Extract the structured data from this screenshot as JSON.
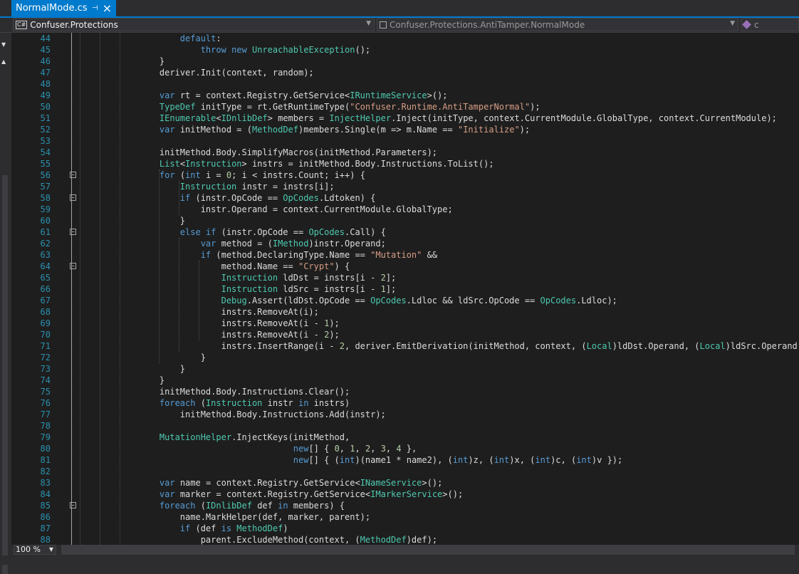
{
  "tab": {
    "title": "NormalMode.cs",
    "pin": "⊣",
    "close": "×"
  },
  "nav": {
    "project_badge": "C#",
    "project": "Confuser.Protections",
    "type": "Confuser.Protections.AntiTamper.NormalMode",
    "member": "c"
  },
  "status": {
    "zoom": "100 %"
  },
  "colors": {
    "accent": "#007acc",
    "line_number": "#2b91af",
    "keyword": "#569cd6",
    "type": "#4ec9b0",
    "string": "#d69d85",
    "number": "#b5cea8"
  },
  "code_lines": [
    {
      "n": "44",
      "fold": false,
      "t": [
        [
          "tx",
          "        "
        ],
        [
          "kw",
          "default"
        ],
        [
          "tx",
          ":"
        ]
      ]
    },
    {
      "n": "45",
      "fold": false,
      "t": [
        [
          "tx",
          "            "
        ],
        [
          "kw",
          "throw"
        ],
        [
          "tx",
          " "
        ],
        [
          "kw",
          "new"
        ],
        [
          "tx",
          " "
        ],
        [
          "ty",
          "UnreachableException"
        ],
        [
          "tx",
          "();"
        ]
      ]
    },
    {
      "n": "46",
      "fold": false,
      "t": [
        [
          "tx",
          "    }"
        ]
      ]
    },
    {
      "n": "47",
      "fold": false,
      "t": [
        [
          "tx",
          "    deriver.Init(context, random);"
        ]
      ]
    },
    {
      "n": "48",
      "fold": false,
      "t": []
    },
    {
      "n": "49",
      "fold": false,
      "t": [
        [
          "tx",
          "    "
        ],
        [
          "kw",
          "var"
        ],
        [
          "tx",
          " rt = context.Registry.GetService<"
        ],
        [
          "ty",
          "IRuntimeService"
        ],
        [
          "tx",
          ">();"
        ]
      ]
    },
    {
      "n": "50",
      "fold": false,
      "t": [
        [
          "tx",
          "    "
        ],
        [
          "ty",
          "TypeDef"
        ],
        [
          "tx",
          " initType = rt.GetRuntimeType("
        ],
        [
          "st",
          "\"Confuser.Runtime.AntiTamperNormal\""
        ],
        [
          "tx",
          ");"
        ]
      ]
    },
    {
      "n": "51",
      "fold": false,
      "t": [
        [
          "tx",
          "    "
        ],
        [
          "ty",
          "IEnumerable"
        ],
        [
          "tx",
          "<"
        ],
        [
          "ty",
          "IDnlibDef"
        ],
        [
          "tx",
          "> members = "
        ],
        [
          "ty",
          "InjectHelper"
        ],
        [
          "tx",
          ".Inject(initType, context.CurrentModule.GlobalType, context.CurrentModule);"
        ]
      ]
    },
    {
      "n": "52",
      "fold": false,
      "t": [
        [
          "tx",
          "    "
        ],
        [
          "kw",
          "var"
        ],
        [
          "tx",
          " initMethod = ("
        ],
        [
          "ty",
          "MethodDef"
        ],
        [
          "tx",
          ")members.Single(m => m.Name == "
        ],
        [
          "st",
          "\"Initialize\""
        ],
        [
          "tx",
          ");"
        ]
      ]
    },
    {
      "n": "53",
      "fold": false,
      "t": []
    },
    {
      "n": "54",
      "fold": false,
      "t": [
        [
          "tx",
          "    initMethod.Body.SimplifyMacros(initMethod.Parameters);"
        ]
      ]
    },
    {
      "n": "55",
      "fold": false,
      "t": [
        [
          "tx",
          "    "
        ],
        [
          "ty",
          "List"
        ],
        [
          "tx",
          "<"
        ],
        [
          "ty",
          "Instruction"
        ],
        [
          "tx",
          "> instrs = initMethod.Body.Instructions.ToList();"
        ]
      ]
    },
    {
      "n": "56",
      "fold": true,
      "t": [
        [
          "tx",
          "    "
        ],
        [
          "kw",
          "for"
        ],
        [
          "tx",
          " ("
        ],
        [
          "kw",
          "int"
        ],
        [
          "tx",
          " i = "
        ],
        [
          "nm",
          "0"
        ],
        [
          "tx",
          "; i < instrs.Count; i++) {"
        ]
      ]
    },
    {
      "n": "57",
      "fold": false,
      "t": [
        [
          "tx",
          "        "
        ],
        [
          "ty",
          "Instruction"
        ],
        [
          "tx",
          " instr = instrs[i];"
        ]
      ]
    },
    {
      "n": "58",
      "fold": true,
      "t": [
        [
          "tx",
          "        "
        ],
        [
          "kw",
          "if"
        ],
        [
          "tx",
          " (instr.OpCode == "
        ],
        [
          "ty",
          "OpCodes"
        ],
        [
          "tx",
          ".Ldtoken) {"
        ]
      ]
    },
    {
      "n": "59",
      "fold": false,
      "t": [
        [
          "tx",
          "            instr.Operand = context.CurrentModule.GlobalType;"
        ]
      ]
    },
    {
      "n": "60",
      "fold": false,
      "t": [
        [
          "tx",
          "        }"
        ]
      ]
    },
    {
      "n": "61",
      "fold": true,
      "t": [
        [
          "tx",
          "        "
        ],
        [
          "kw",
          "else"
        ],
        [
          "tx",
          " "
        ],
        [
          "kw",
          "if"
        ],
        [
          "tx",
          " (instr.OpCode == "
        ],
        [
          "ty",
          "OpCodes"
        ],
        [
          "tx",
          ".Call) {"
        ]
      ]
    },
    {
      "n": "62",
      "fold": false,
      "t": [
        [
          "tx",
          "            "
        ],
        [
          "kw",
          "var"
        ],
        [
          "tx",
          " method = ("
        ],
        [
          "ty",
          "IMethod"
        ],
        [
          "tx",
          ")instr.Operand;"
        ]
      ]
    },
    {
      "n": "63",
      "fold": false,
      "t": [
        [
          "tx",
          "            "
        ],
        [
          "kw",
          "if"
        ],
        [
          "tx",
          " (method.DeclaringType.Name == "
        ],
        [
          "st",
          "\"Mutation\""
        ],
        [
          "tx",
          " &&"
        ]
      ]
    },
    {
      "n": "64",
      "fold": true,
      "t": [
        [
          "tx",
          "                method.Name == "
        ],
        [
          "st",
          "\"Crypt\""
        ],
        [
          "tx",
          ") {"
        ]
      ]
    },
    {
      "n": "65",
      "fold": false,
      "t": [
        [
          "tx",
          "                "
        ],
        [
          "ty",
          "Instruction"
        ],
        [
          "tx",
          " ldDst = instrs[i - "
        ],
        [
          "nm",
          "2"
        ],
        [
          "tx",
          "];"
        ]
      ]
    },
    {
      "n": "66",
      "fold": false,
      "t": [
        [
          "tx",
          "                "
        ],
        [
          "ty",
          "Instruction"
        ],
        [
          "tx",
          " ldSrc = instrs[i - "
        ],
        [
          "nm",
          "1"
        ],
        [
          "tx",
          "];"
        ]
      ]
    },
    {
      "n": "67",
      "fold": false,
      "t": [
        [
          "tx",
          "                "
        ],
        [
          "ty",
          "Debug"
        ],
        [
          "tx",
          ".Assert(ldDst.OpCode == "
        ],
        [
          "ty",
          "OpCodes"
        ],
        [
          "tx",
          ".Ldloc && ldSrc.OpCode == "
        ],
        [
          "ty",
          "OpCodes"
        ],
        [
          "tx",
          ".Ldloc);"
        ]
      ]
    },
    {
      "n": "68",
      "fold": false,
      "t": [
        [
          "tx",
          "                instrs.RemoveAt(i);"
        ]
      ]
    },
    {
      "n": "69",
      "fold": false,
      "t": [
        [
          "tx",
          "                instrs.RemoveAt(i - "
        ],
        [
          "nm",
          "1"
        ],
        [
          "tx",
          ");"
        ]
      ]
    },
    {
      "n": "70",
      "fold": false,
      "t": [
        [
          "tx",
          "                instrs.RemoveAt(i - "
        ],
        [
          "nm",
          "2"
        ],
        [
          "tx",
          ");"
        ]
      ]
    },
    {
      "n": "71",
      "fold": false,
      "t": [
        [
          "tx",
          "                instrs.InsertRange(i - "
        ],
        [
          "nm",
          "2"
        ],
        [
          "tx",
          ", deriver.EmitDerivation(initMethod, context, ("
        ],
        [
          "ty",
          "Local"
        ],
        [
          "tx",
          ")ldDst.Operand, ("
        ],
        [
          "ty",
          "Local"
        ],
        [
          "tx",
          ")ldSrc.Operand));"
        ]
      ]
    },
    {
      "n": "72",
      "fold": false,
      "t": [
        [
          "tx",
          "            }"
        ]
      ]
    },
    {
      "n": "73",
      "fold": false,
      "t": [
        [
          "tx",
          "        }"
        ]
      ]
    },
    {
      "n": "74",
      "fold": false,
      "t": [
        [
          "tx",
          "    }"
        ]
      ]
    },
    {
      "n": "75",
      "fold": false,
      "t": [
        [
          "tx",
          "    initMethod.Body.Instructions.Clear();"
        ]
      ]
    },
    {
      "n": "76",
      "fold": false,
      "t": [
        [
          "tx",
          "    "
        ],
        [
          "kw",
          "foreach"
        ],
        [
          "tx",
          " ("
        ],
        [
          "ty",
          "Instruction"
        ],
        [
          "tx",
          " instr "
        ],
        [
          "kw",
          "in"
        ],
        [
          "tx",
          " instrs)"
        ]
      ]
    },
    {
      "n": "77",
      "fold": false,
      "t": [
        [
          "tx",
          "        initMethod.Body.Instructions.Add(instr);"
        ]
      ]
    },
    {
      "n": "78",
      "fold": false,
      "t": []
    },
    {
      "n": "79",
      "fold": false,
      "t": [
        [
          "tx",
          "    "
        ],
        [
          "ty",
          "MutationHelper"
        ],
        [
          "tx",
          ".InjectKeys(initMethod,"
        ]
      ]
    },
    {
      "n": "80",
      "fold": false,
      "t": [
        [
          "tx",
          "                              "
        ],
        [
          "kw",
          "new"
        ],
        [
          "tx",
          "[] { "
        ],
        [
          "nm",
          "0"
        ],
        [
          "tx",
          ", "
        ],
        [
          "nm",
          "1"
        ],
        [
          "tx",
          ", "
        ],
        [
          "nm",
          "2"
        ],
        [
          "tx",
          ", "
        ],
        [
          "nm",
          "3"
        ],
        [
          "tx",
          ", "
        ],
        [
          "nm",
          "4"
        ],
        [
          "tx",
          " },"
        ]
      ]
    },
    {
      "n": "81",
      "fold": false,
      "t": [
        [
          "tx",
          "                              "
        ],
        [
          "kw",
          "new"
        ],
        [
          "tx",
          "[] { ("
        ],
        [
          "kw",
          "int"
        ],
        [
          "tx",
          ")(name1 * name2), ("
        ],
        [
          "kw",
          "int"
        ],
        [
          "tx",
          ")z, ("
        ],
        [
          "kw",
          "int"
        ],
        [
          "tx",
          ")x, ("
        ],
        [
          "kw",
          "int"
        ],
        [
          "tx",
          ")c, ("
        ],
        [
          "kw",
          "int"
        ],
        [
          "tx",
          ")v });"
        ]
      ]
    },
    {
      "n": "82",
      "fold": false,
      "t": []
    },
    {
      "n": "83",
      "fold": false,
      "t": [
        [
          "tx",
          "    "
        ],
        [
          "kw",
          "var"
        ],
        [
          "tx",
          " name = context.Registry.GetService<"
        ],
        [
          "ty",
          "INameService"
        ],
        [
          "tx",
          ">();"
        ]
      ]
    },
    {
      "n": "84",
      "fold": false,
      "t": [
        [
          "tx",
          "    "
        ],
        [
          "kw",
          "var"
        ],
        [
          "tx",
          " marker = context.Registry.GetService<"
        ],
        [
          "ty",
          "IMarkerService"
        ],
        [
          "tx",
          ">();"
        ]
      ]
    },
    {
      "n": "85",
      "fold": true,
      "t": [
        [
          "tx",
          "    "
        ],
        [
          "kw",
          "foreach"
        ],
        [
          "tx",
          " ("
        ],
        [
          "ty",
          "IDnlibDef"
        ],
        [
          "tx",
          " def "
        ],
        [
          "kw",
          "in"
        ],
        [
          "tx",
          " members) {"
        ]
      ]
    },
    {
      "n": "86",
      "fold": false,
      "t": [
        [
          "tx",
          "        name.MarkHelper(def, marker, parent);"
        ]
      ]
    },
    {
      "n": "87",
      "fold": false,
      "t": [
        [
          "tx",
          "        "
        ],
        [
          "kw",
          "if"
        ],
        [
          "tx",
          " (def "
        ],
        [
          "kw",
          "is"
        ],
        [
          "tx",
          " "
        ],
        [
          "ty",
          "MethodDef"
        ],
        [
          "tx",
          ")"
        ]
      ]
    },
    {
      "n": "88",
      "fold": false,
      "t": [
        [
          "tx",
          "            parent.ExcludeMethod(context, ("
        ],
        [
          "ty",
          "MethodDef"
        ],
        [
          "tx",
          ")def);"
        ]
      ]
    }
  ]
}
